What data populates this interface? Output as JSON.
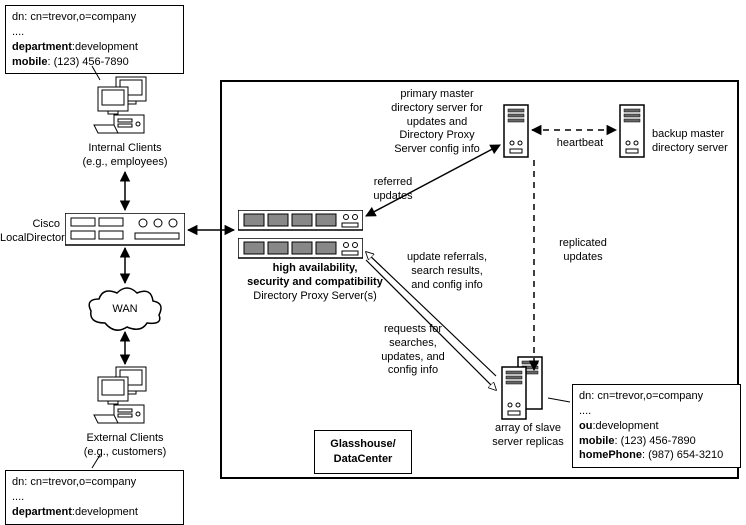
{
  "ldap_top": {
    "l1": "dn: cn=trevor,o=company",
    "l2": "....",
    "l3a": "department",
    "l3b": ":development",
    "l4a": "mobile",
    "l4b": ": (123) 456-7890"
  },
  "ldap_bottom": {
    "l1": "dn: cn=trevor,o=company",
    "l2": "....",
    "l3a": "department",
    "l3b": ":development"
  },
  "ldap_right": {
    "l1": "dn: cn=trevor,o=company",
    "l2": "....",
    "l3a": "ou",
    "l3b": ":development",
    "l4a": "mobile",
    "l4b": ": (123) 456-7890",
    "l5a": "homePhone",
    "l5b": ": (987) 654-3210"
  },
  "labels": {
    "internal_clients_l1": "Internal Clients",
    "internal_clients_l2": "(e.g., employees)",
    "external_clients_l1": "External Clients",
    "external_clients_l2": "(e.g., customers)",
    "cisco_l1": "Cisco",
    "cisco_l2": "LocalDirector",
    "wan": "WAN",
    "proxy_l1": "high availability,",
    "proxy_l2": "security and compatibility",
    "proxy_l3": "Directory Proxy Server(s)",
    "primary_l1": "primary master",
    "primary_l2": "directory server for",
    "primary_l3": "updates and",
    "primary_l4": "Directory Proxy",
    "primary_l5": "Server config info",
    "backup_l1": "backup master",
    "backup_l2": "directory server",
    "heartbeat": "heartbeat",
    "referred_l1": "referred",
    "referred_l2": "updates",
    "referrals_l1": "update referrals,",
    "referrals_l2": "search results,",
    "referrals_l3": "and config info",
    "replicated_l1": "replicated",
    "replicated_l2": "updates",
    "requests_l1": "requests for",
    "requests_l2": "searches,",
    "requests_l3": "updates, and",
    "requests_l4": "config info",
    "slave_l1": "array of slave",
    "slave_l2": "server replicas",
    "datacenter_l1": "Glasshouse/",
    "datacenter_l2": "DataCenter"
  }
}
